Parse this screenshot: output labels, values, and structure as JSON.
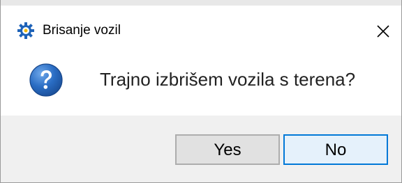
{
  "window": {
    "title": "Brisanje vozil",
    "app_icon": "gear-icon",
    "close_icon": "close-icon"
  },
  "dialog": {
    "icon": "question-icon",
    "message": "Trajno izbrišem vozila s terena?"
  },
  "buttons": {
    "yes_label": "Yes",
    "no_label": "No"
  },
  "colors": {
    "accent_border": "#0078d7",
    "icon_blue": "#1f63b8",
    "footer_bg": "#f0f0f0"
  }
}
